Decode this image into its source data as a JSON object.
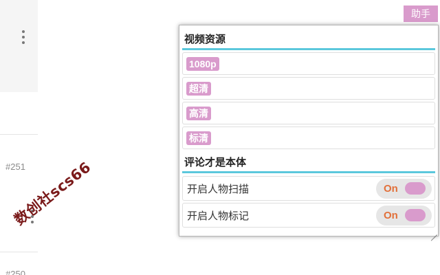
{
  "background": {
    "post_numbers": [
      "#251",
      "#250"
    ],
    "watermark": "数创社scs66"
  },
  "helper_button": {
    "label": "助手"
  },
  "panel": {
    "video_section": {
      "title": "视频资源",
      "resources": [
        "1080p",
        "超清",
        "高清",
        "标清"
      ]
    },
    "comment_section": {
      "title": "评论才是本体",
      "toggles": [
        {
          "label": "开启人物扫描",
          "state": "On"
        },
        {
          "label": "开启人物标记",
          "state": "On"
        }
      ]
    }
  },
  "colors": {
    "accent_pink": "#d99bcc",
    "section_underline": "#5bc8dc",
    "toggle_on_text": "#e2703a",
    "watermark": "#7a1a1a"
  },
  "icons": [
    "more-vertical-icon",
    "resize-grip-icon"
  ]
}
